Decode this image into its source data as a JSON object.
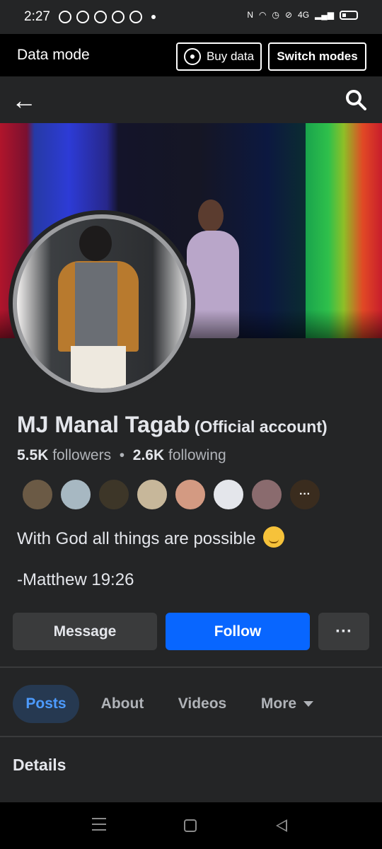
{
  "status_bar": {
    "time": "2:27",
    "network": "4G"
  },
  "data_mode": {
    "label": "Data mode",
    "buy_label": "Buy data",
    "switch_label": "Switch modes"
  },
  "profile": {
    "name": "MJ Manal Tagab",
    "badge": "(Official account)",
    "followers_count": "5.5K",
    "followers_label": "followers",
    "separator": "•",
    "following_count": "2.6K",
    "following_label": "following",
    "bio_line1": "With God all things are possible",
    "bio_line2": "-Matthew 19:26"
  },
  "actions": {
    "message_label": "Message",
    "follow_label": "Follow",
    "more_label": "···"
  },
  "friends": {
    "more_label": "···"
  },
  "tabs": [
    {
      "label": "Posts",
      "active": true
    },
    {
      "label": "About",
      "active": false
    },
    {
      "label": "Videos",
      "active": false
    },
    {
      "label": "More",
      "active": false
    }
  ],
  "section": {
    "details_title": "Details"
  },
  "colors": {
    "accent": "#0866ff",
    "background": "#242526",
    "tab_active_bg": "#263951",
    "tab_active_text": "#4d9bff"
  }
}
